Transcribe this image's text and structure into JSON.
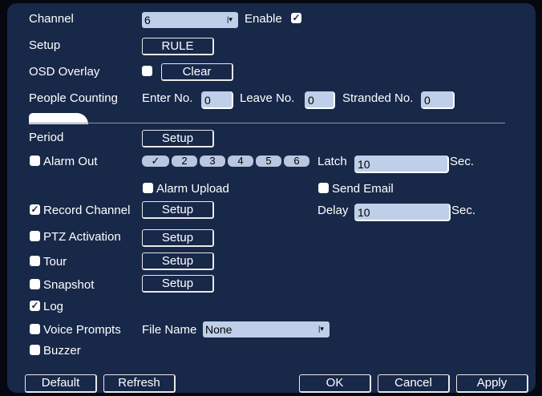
{
  "channel": {
    "label": "Channel",
    "value": "6",
    "enable_label": "Enable",
    "enabled": true
  },
  "setup": {
    "label": "Setup",
    "rule_button": "RULE"
  },
  "osd": {
    "label": "OSD Overlay",
    "checked": false,
    "clear_button": "Clear"
  },
  "people_counting": {
    "label": "People Counting",
    "enter_label": "Enter No.",
    "enter_value": "0",
    "leave_label": "Leave No.",
    "leave_value": "0",
    "stranded_label": "Stranded No.",
    "stranded_value": "0"
  },
  "period": {
    "label": "Period",
    "setup_button": "Setup"
  },
  "alarm_out": {
    "label": "Alarm Out",
    "checked": false,
    "channels": [
      "2",
      "3",
      "4",
      "5",
      "6"
    ],
    "latch_label": "Latch",
    "latch_value": "10",
    "latch_unit": "Sec."
  },
  "alarm_upload": {
    "label": "Alarm Upload",
    "checked": false
  },
  "send_email": {
    "label": "Send Email",
    "checked": false
  },
  "record_channel": {
    "label": "Record Channel",
    "checked": true,
    "setup_button": "Setup",
    "delay_label": "Delay",
    "delay_value": "10",
    "delay_unit": "Sec."
  },
  "ptz": {
    "label": "PTZ Activation",
    "checked": false,
    "setup_button": "Setup"
  },
  "tour": {
    "label": "Tour",
    "checked": false,
    "setup_button": "Setup"
  },
  "snapshot": {
    "label": "Snapshot",
    "checked": false,
    "setup_button": "Setup"
  },
  "log": {
    "label": "Log",
    "checked": true
  },
  "voice_prompts": {
    "label": "Voice Prompts",
    "checked": false,
    "file_name_label": "File Name",
    "file_value": "None"
  },
  "buzzer": {
    "label": "Buzzer",
    "checked": false
  },
  "footer": {
    "default": "Default",
    "refresh": "Refresh",
    "ok": "OK",
    "cancel": "Cancel",
    "apply": "Apply"
  },
  "icons": {
    "checkbox_checked": "checkmark-icon",
    "dropdown": "dropdown-arrow-icon"
  },
  "colors": {
    "panel": "#182849",
    "background": "#050810",
    "field": "#bfcfe9"
  }
}
